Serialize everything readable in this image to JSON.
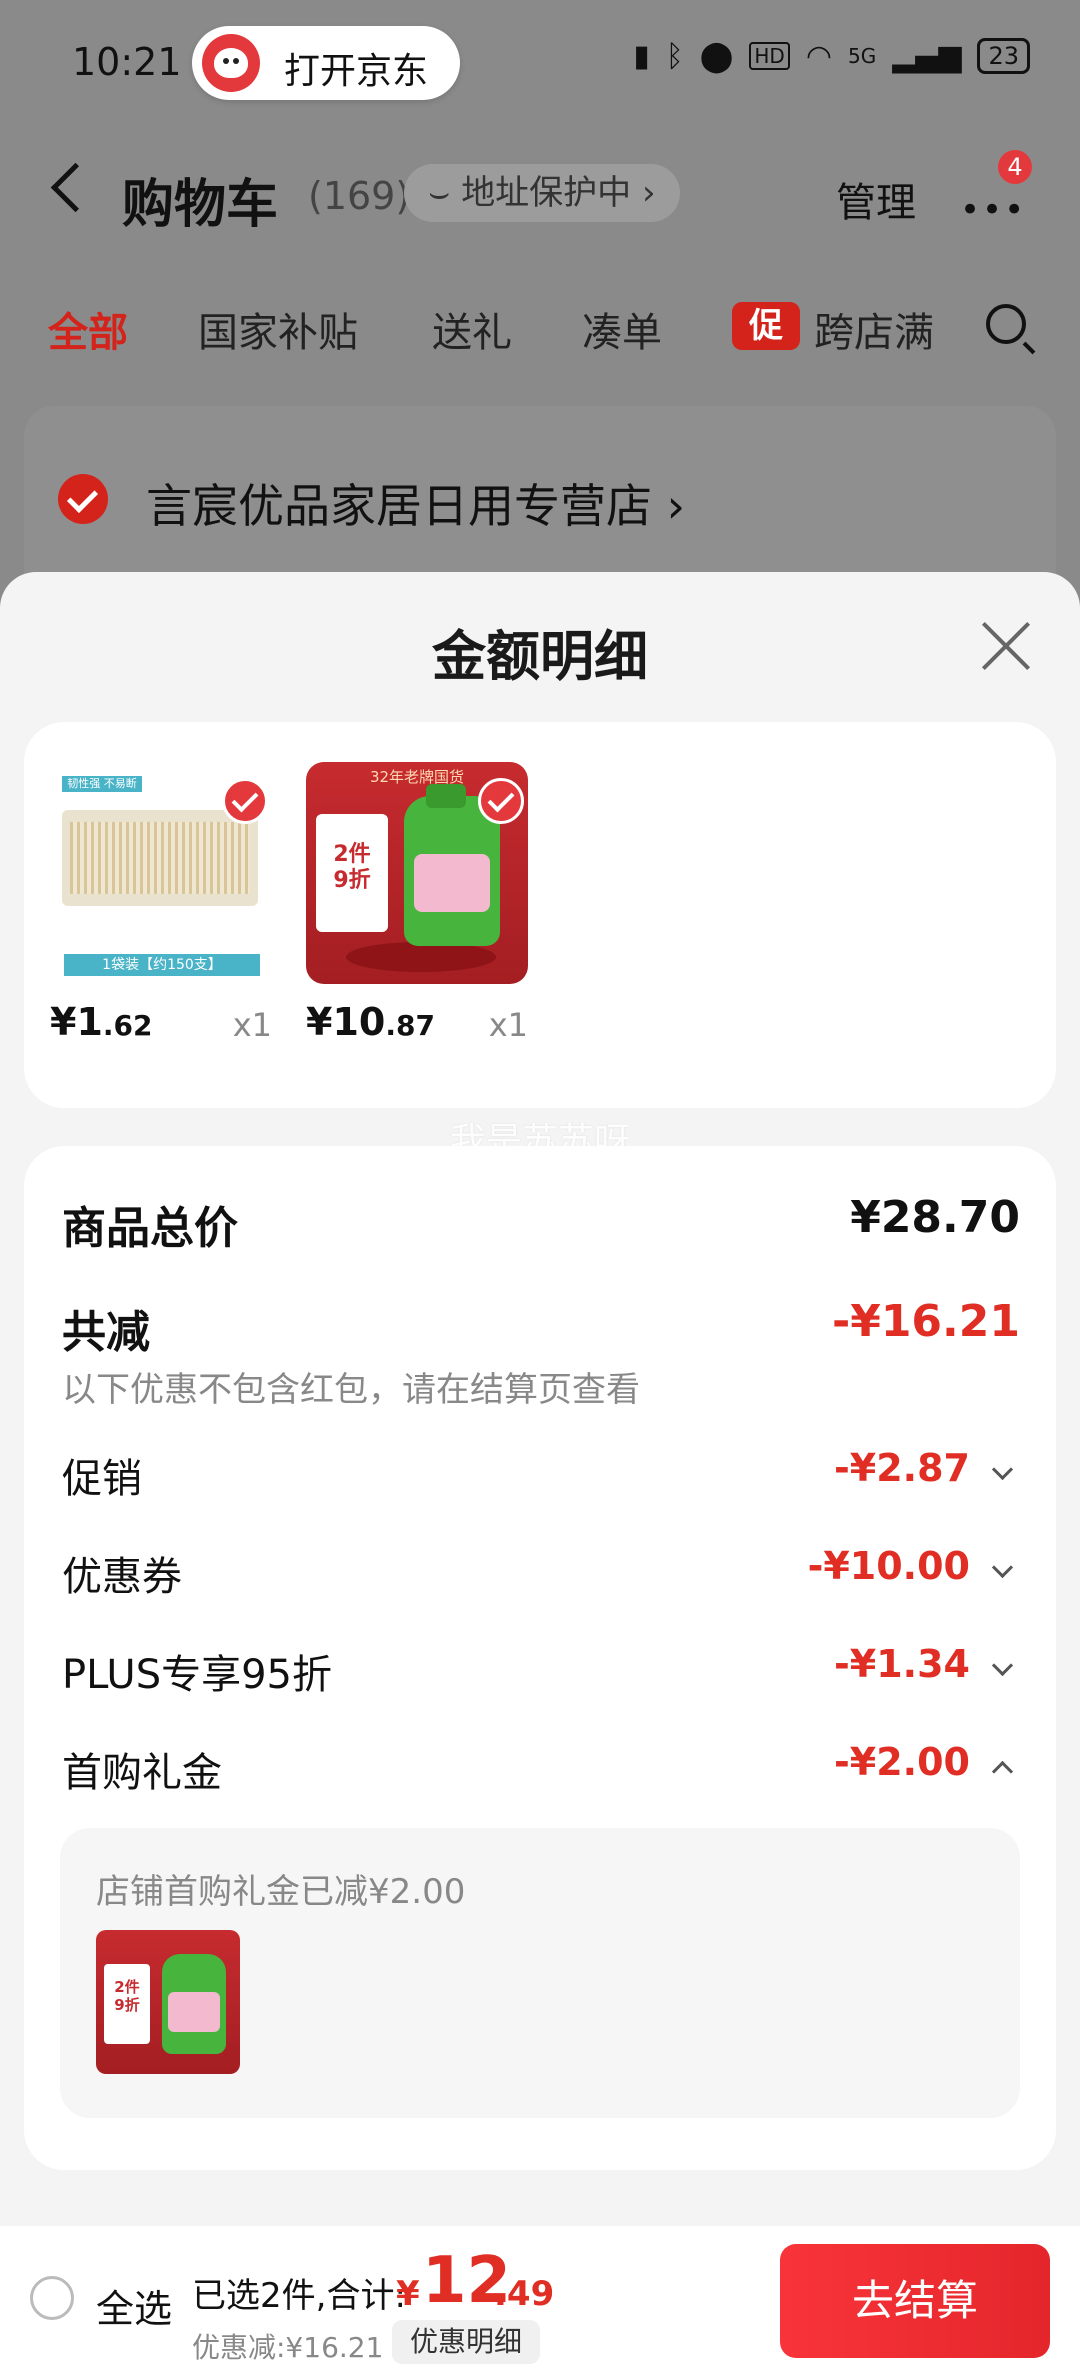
{
  "status_bar": {
    "time": "10:21",
    "open_app": "打开京东",
    "network": "5G",
    "battery": "23"
  },
  "header": {
    "title": "购物车",
    "count": "(169)",
    "address_protect": "地址保护中",
    "address_chevron": "›",
    "manage": "管理",
    "more_badge": "4"
  },
  "tabs": [
    {
      "label": "全部",
      "active": true
    },
    {
      "label": "国家补贴"
    },
    {
      "label": "送礼"
    },
    {
      "label": "凑单"
    },
    {
      "label": "跨店满",
      "tag": "促"
    }
  ],
  "store": {
    "name": "言宸优品家居日用专营店",
    "chevron": "›"
  },
  "sheet": {
    "title": "金额明细",
    "products": [
      {
        "name": "toothpick",
        "price_int": "¥1",
        "price_dec": ".62",
        "qty": "x1",
        "banner": "1袋装【约150支】",
        "tag": "韧性强 不易断"
      },
      {
        "name": "detergent",
        "price_int": "¥10",
        "price_dec": ".87",
        "qty": "x1",
        "banner": "32年老牌国货",
        "promo": "2件\n9折"
      }
    ],
    "watermark": "我是苏苏呀",
    "summary": {
      "total_label": "商品总价",
      "total_value": "¥28.70",
      "discount_label": "共减",
      "discount_value": "-¥16.21",
      "discount_note": "以下优惠不包含红包，请在结算页查看",
      "rows": [
        {
          "label": "促销",
          "value": "-¥2.87",
          "expanded": false
        },
        {
          "label": "优惠券",
          "value": "-¥10.00",
          "expanded": false
        },
        {
          "label": "PLUS专享95折",
          "value": "-¥1.34",
          "expanded": false
        },
        {
          "label": "首购礼金",
          "value": "-¥2.00",
          "expanded": true
        }
      ],
      "gift_note": "店铺首购礼金已减¥2.00"
    }
  },
  "bottom_bar": {
    "select_all": "全选",
    "selected": "已选2件,合计:",
    "yen": "¥",
    "total_int": "12",
    "total_dec": ".49",
    "saved": "优惠减:¥16.21",
    "detail": "优惠明细",
    "checkout": "去结算"
  },
  "colors": {
    "accent_red": "#e02e24",
    "checkout_red": "#f8343a",
    "sheet_bg": "#f4f4f4"
  }
}
